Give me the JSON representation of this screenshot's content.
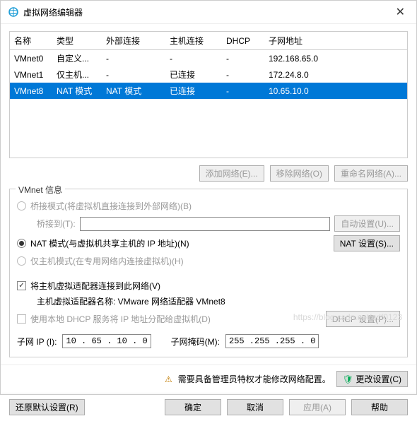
{
  "window": {
    "title": "虚拟网络编辑器"
  },
  "table": {
    "headers": [
      "名称",
      "类型",
      "外部连接",
      "主机连接",
      "DHCP",
      "子网地址"
    ],
    "rows": [
      {
        "cells": [
          "VMnet0",
          "自定义...",
          "-",
          "-",
          "-",
          "192.168.65.0"
        ],
        "selected": false
      },
      {
        "cells": [
          "VMnet1",
          "仅主机...",
          "-",
          "已连接",
          "-",
          "172.24.8.0"
        ],
        "selected": false
      },
      {
        "cells": [
          "VMnet8",
          "NAT 模式",
          "NAT 模式",
          "已连接",
          "-",
          "10.65.10.0"
        ],
        "selected": true
      }
    ]
  },
  "midButtons": {
    "add": "添加网络(E)...",
    "remove": "移除网络(O)",
    "rename": "重命名网络(A)..."
  },
  "group": {
    "title": "VMnet 信息",
    "bridged": "桥接模式(将虚拟机直接连接到外部网络)(B)",
    "bridgedTo": "桥接到(T):",
    "autoBtn": "自动设置(U)...",
    "nat": "NAT 模式(与虚拟机共享主机的 IP 地址)(N)",
    "natBtn": "NAT 设置(S)...",
    "hostonly": "仅主机模式(在专用网络内连接虚拟机)(H)",
    "hostAdapter": "将主机虚拟适配器连接到此网络(V)",
    "hostAdapterName": "主机虚拟适配器名称: VMware 网络适配器 VMnet8",
    "dhcp": "使用本地 DHCP 服务将 IP 地址分配给虚拟机(D)",
    "dhcpBtn": "DHCP 设置(P)...",
    "subnetIpLbl": "子网 IP (I):",
    "subnetIp": "10 . 65 . 10 .  0",
    "subnetMaskLbl": "子网掩码(M):",
    "subnetMask": "255 .255 .255 .  0"
  },
  "notice": {
    "text": "需要具备管理员特权才能修改网络配置。",
    "changeBtn": "更改设置(C)"
  },
  "footer": {
    "restore": "还原默认设置(R)",
    "ok": "确定",
    "cancel": "取消",
    "apply": "应用(A)",
    "help": "帮助"
  },
  "watermark": "https://blog.csdn.net/qdf0123"
}
